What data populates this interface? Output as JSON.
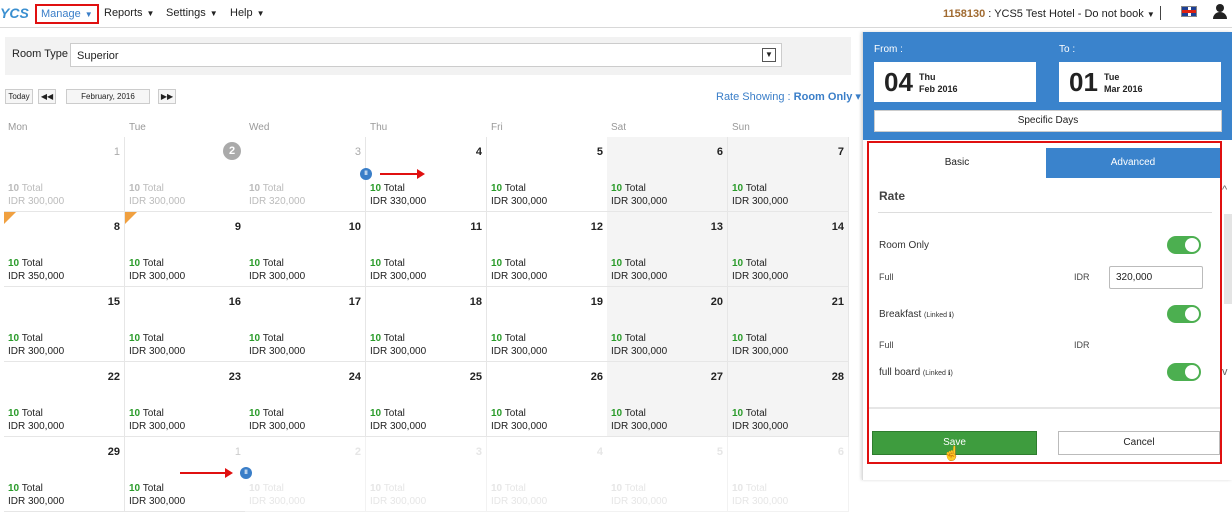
{
  "nav": {
    "logo": "YCS",
    "menu": [
      {
        "label": "Manage",
        "caret": "▼"
      },
      {
        "label": "Reports",
        "caret": "▼"
      },
      {
        "label": "Settings",
        "caret": "▼"
      },
      {
        "label": "Help",
        "caret": "▼"
      }
    ],
    "hotel_code": "1158130",
    "hotel_name": " : YCS5 Test Hotel - Do not book",
    "hotel_caret": "▼"
  },
  "room_type": {
    "label": "Room Type :",
    "value": "Superior",
    "dropdown_icon": "▼"
  },
  "controls": {
    "today": "Today",
    "prev": "◀◀",
    "month": "February, 2016",
    "next": "▶▶"
  },
  "rate_showing": {
    "label": "Rate Showing :",
    "value": "Room Only",
    "caret": "▾"
  },
  "days": [
    "Mon",
    "Tue",
    "Wed",
    "Thu",
    "Fri",
    "Sat",
    "Sun"
  ],
  "calendar": [
    [
      {
        "day": "1",
        "total": "10",
        "price": "IDR 300,000",
        "style": "muted"
      },
      {
        "day": "2",
        "total": "10",
        "price": "IDR 300,000",
        "style": "muted",
        "today": true
      },
      {
        "day": "3",
        "total": "10",
        "price": "IDR 320,000",
        "style": "muted"
      },
      {
        "day": "4",
        "total": "10",
        "price": "IDR 330,000",
        "style": "normal"
      },
      {
        "day": "5",
        "total": "10",
        "price": "IDR 300,000",
        "style": "normal"
      },
      {
        "day": "6",
        "total": "10",
        "price": "IDR 300,000",
        "style": "weekend"
      },
      {
        "day": "7",
        "total": "10",
        "price": "IDR 300,000",
        "style": "weekend"
      }
    ],
    [
      {
        "day": "8",
        "total": "10",
        "price": "IDR 350,000",
        "style": "normal",
        "corner": true
      },
      {
        "day": "9",
        "total": "10",
        "price": "IDR 300,000",
        "style": "normal",
        "corner": true
      },
      {
        "day": "10",
        "total": "10",
        "price": "IDR 300,000",
        "style": "normal"
      },
      {
        "day": "11",
        "total": "10",
        "price": "IDR 300,000",
        "style": "normal"
      },
      {
        "day": "12",
        "total": "10",
        "price": "IDR 300,000",
        "style": "normal"
      },
      {
        "day": "13",
        "total": "10",
        "price": "IDR 300,000",
        "style": "weekend"
      },
      {
        "day": "14",
        "total": "10",
        "price": "IDR 300,000",
        "style": "weekend"
      }
    ],
    [
      {
        "day": "15",
        "total": "10",
        "price": "IDR 300,000",
        "style": "normal"
      },
      {
        "day": "16",
        "total": "10",
        "price": "IDR 300,000",
        "style": "normal"
      },
      {
        "day": "17",
        "total": "10",
        "price": "IDR 300,000",
        "style": "normal"
      },
      {
        "day": "18",
        "total": "10",
        "price": "IDR 300,000",
        "style": "normal"
      },
      {
        "day": "19",
        "total": "10",
        "price": "IDR 300,000",
        "style": "normal"
      },
      {
        "day": "20",
        "total": "10",
        "price": "IDR 300,000",
        "style": "weekend"
      },
      {
        "day": "21",
        "total": "10",
        "price": "IDR 300,000",
        "style": "weekend"
      }
    ],
    [
      {
        "day": "22",
        "total": "10",
        "price": "IDR 300,000",
        "style": "normal"
      },
      {
        "day": "23",
        "total": "10",
        "price": "IDR 300,000",
        "style": "normal"
      },
      {
        "day": "24",
        "total": "10",
        "price": "IDR 300,000",
        "style": "normal"
      },
      {
        "day": "25",
        "total": "10",
        "price": "IDR 300,000",
        "style": "normal"
      },
      {
        "day": "26",
        "total": "10",
        "price": "IDR 300,000",
        "style": "normal"
      },
      {
        "day": "27",
        "total": "10",
        "price": "IDR 300,000",
        "style": "weekend"
      },
      {
        "day": "28",
        "total": "10",
        "price": "IDR 300,000",
        "style": "weekend"
      }
    ],
    [
      {
        "day": "29",
        "total": "10",
        "price": "IDR 300,000",
        "style": "normal"
      },
      {
        "day": "1",
        "total": "10",
        "price": "IDR 300,000",
        "style": "normal",
        "day_muted": true
      },
      {
        "day": "2",
        "total": "10",
        "price": "IDR 300,000",
        "style": "faded"
      },
      {
        "day": "3",
        "total": "10",
        "price": "IDR 300,000",
        "style": "faded"
      },
      {
        "day": "4",
        "total": "10",
        "price": "IDR 300,000",
        "style": "faded"
      },
      {
        "day": "5",
        "total": "10",
        "price": "IDR 300,000",
        "style": "faded"
      },
      {
        "day": "6",
        "total": "10",
        "price": "IDR 300,000",
        "style": "faded"
      }
    ]
  ],
  "total_suffix": " Total",
  "panel": {
    "from_label": "From :",
    "to_label": "To :",
    "from": {
      "day": "04",
      "dow": "Thu",
      "md": "Feb 2016"
    },
    "to": {
      "day": "01",
      "dow": "Tue",
      "md": "Mar 2016"
    },
    "specific_days": "Specific Days",
    "tabs": {
      "basic": "Basic",
      "advanced": "Advanced"
    },
    "rate_title": "Rate",
    "room_only": "Room Only",
    "full": "Full",
    "currency": "IDR",
    "price_value": "320,000",
    "breakfast": "Breakfast",
    "full_board": "full board",
    "linked": "(Linked ℹ)",
    "save": "Save",
    "cancel": "Cancel"
  },
  "colors": {
    "accent": "#3a83cc",
    "green": "#4caf50",
    "highlight": "#e01010"
  }
}
